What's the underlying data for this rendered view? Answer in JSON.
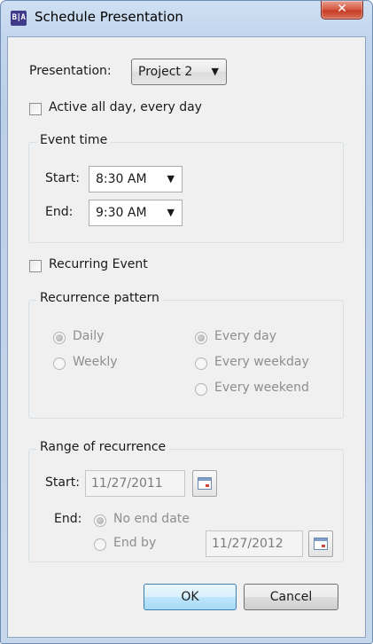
{
  "window": {
    "title": "Schedule Presentation",
    "icon_text": "B|A",
    "close_glyph": "✕"
  },
  "presentation": {
    "label": "Presentation:",
    "selected": "Project 2"
  },
  "active_all_day": {
    "label": "Active all day, every day",
    "checked": false
  },
  "event_time": {
    "legend": "Event time",
    "start_label": "Start:",
    "start_value": "8:30 AM",
    "end_label": "End:",
    "end_value": "9:30 AM"
  },
  "recurring_event": {
    "label": "Recurring Event",
    "checked": false
  },
  "recurrence_pattern": {
    "legend": "Recurrence pattern",
    "daily": "Daily",
    "weekly": "Weekly",
    "every_day": "Every day",
    "every_weekday": "Every weekday",
    "every_weekend": "Every weekend"
  },
  "range_of_recurrence": {
    "legend": "Range of recurrence",
    "start_label": "Start:",
    "start_date": "11/27/2011",
    "end_label": "End:",
    "no_end_date": "No end date",
    "end_by": "End by",
    "end_date": "11/27/2012"
  },
  "buttons": {
    "ok": "OK",
    "cancel": "Cancel"
  },
  "icons": {
    "dropdown_arrow": "▼",
    "calendar": "calendar-icon"
  }
}
